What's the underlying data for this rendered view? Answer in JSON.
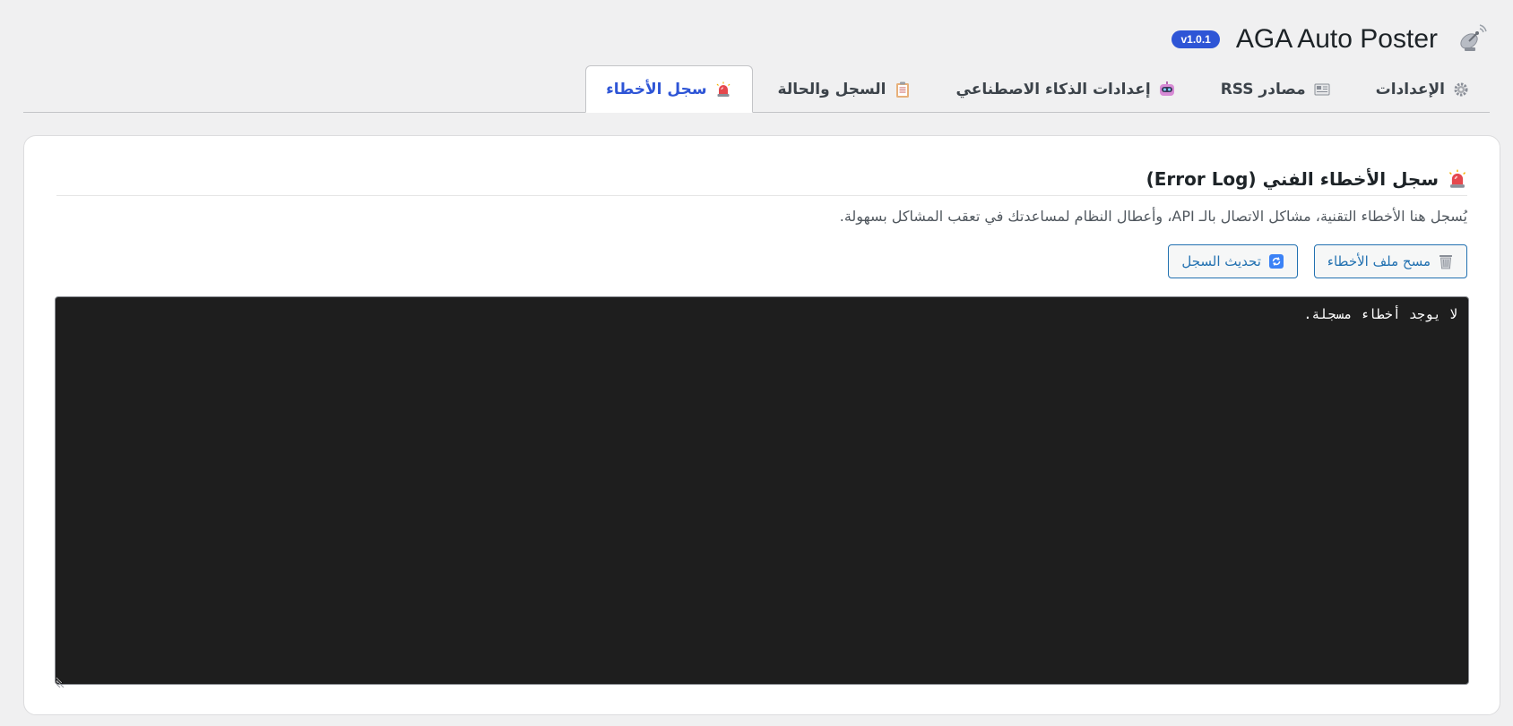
{
  "header": {
    "title": "AGA Auto Poster",
    "version": "v1.0.1",
    "logo_icon": "satellite-dish-icon"
  },
  "tabs": [
    {
      "label": "الإعدادات",
      "icon": "gear-icon",
      "active": false
    },
    {
      "label": "مصادر RSS",
      "icon": "newspaper-icon",
      "active": false
    },
    {
      "label": "إعدادات الذكاء الاصطناعي",
      "icon": "robot-icon",
      "active": false
    },
    {
      "label": "السجل والحالة",
      "icon": "clipboard-icon",
      "active": false
    },
    {
      "label": "سجل الأخطاء",
      "icon": "siren-icon",
      "active": true
    }
  ],
  "card": {
    "title": "سجل الأخطاء الفني (Error Log)",
    "title_icon": "siren-icon",
    "description": "يُسجل هنا الأخطاء التقنية، مشاكل الاتصال بالـ API، وأعطال النظام لمساعدتك في تعقب المشاكل بسهولة.",
    "buttons": {
      "clear_label": "مسح ملف الأخطاء",
      "clear_icon": "wastebasket-icon",
      "refresh_label": "تحديث السجل",
      "refresh_icon": "refresh-icon"
    },
    "log_content": "لا يوجد أخطاء مسجلة."
  },
  "colors": {
    "accent": "#2e55d6",
    "button": "#2271b1",
    "log_background": "#1e1e1e",
    "page_background": "#f0f0f1"
  }
}
